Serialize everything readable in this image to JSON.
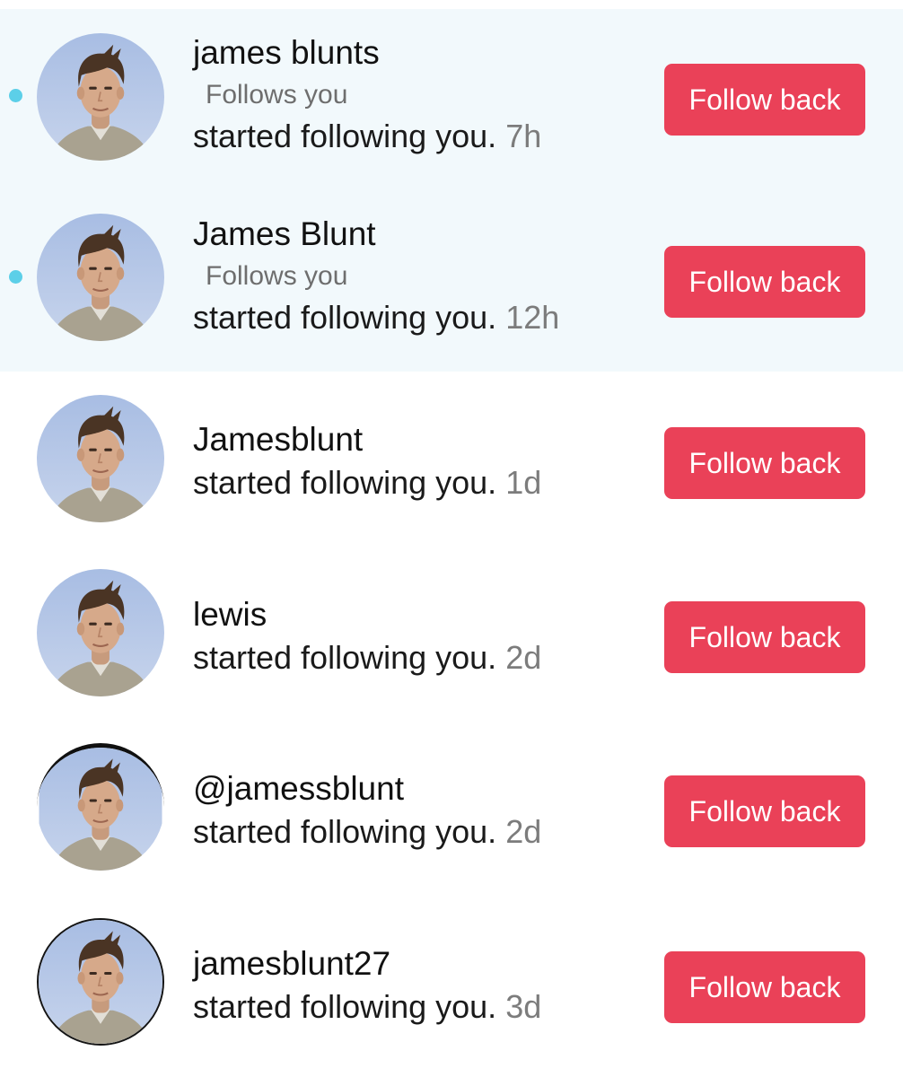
{
  "notifications": [
    {
      "username": "james blunts",
      "follows_you": "Follows you",
      "activity": "started following you.",
      "time": "7h",
      "button": "Follow back",
      "unread": true
    },
    {
      "username": "James Blunt",
      "follows_you": "Follows you",
      "activity": "started following you.",
      "time": "12h",
      "button": "Follow back",
      "unread": true
    },
    {
      "username": "Jamesblunt",
      "activity": "started following you.",
      "time": "1d",
      "button": "Follow back",
      "unread": false
    },
    {
      "username": "lewis",
      "activity": "started following you.",
      "time": "2d",
      "button": "Follow back",
      "unread": false
    },
    {
      "username": "@jamessblunt",
      "activity": "started following you.",
      "time": "2d",
      "button": "Follow back",
      "unread": false
    },
    {
      "username": "jamesblunt27",
      "activity": "started following you.",
      "time": "3d",
      "button": "Follow back",
      "unread": false
    }
  ],
  "colors": {
    "button_bg": "#ea4158",
    "unread_bg": "#f2f9fc",
    "unread_dot": "#5ccfe8"
  },
  "icons": {
    "avatar": "profile-photo-man"
  }
}
